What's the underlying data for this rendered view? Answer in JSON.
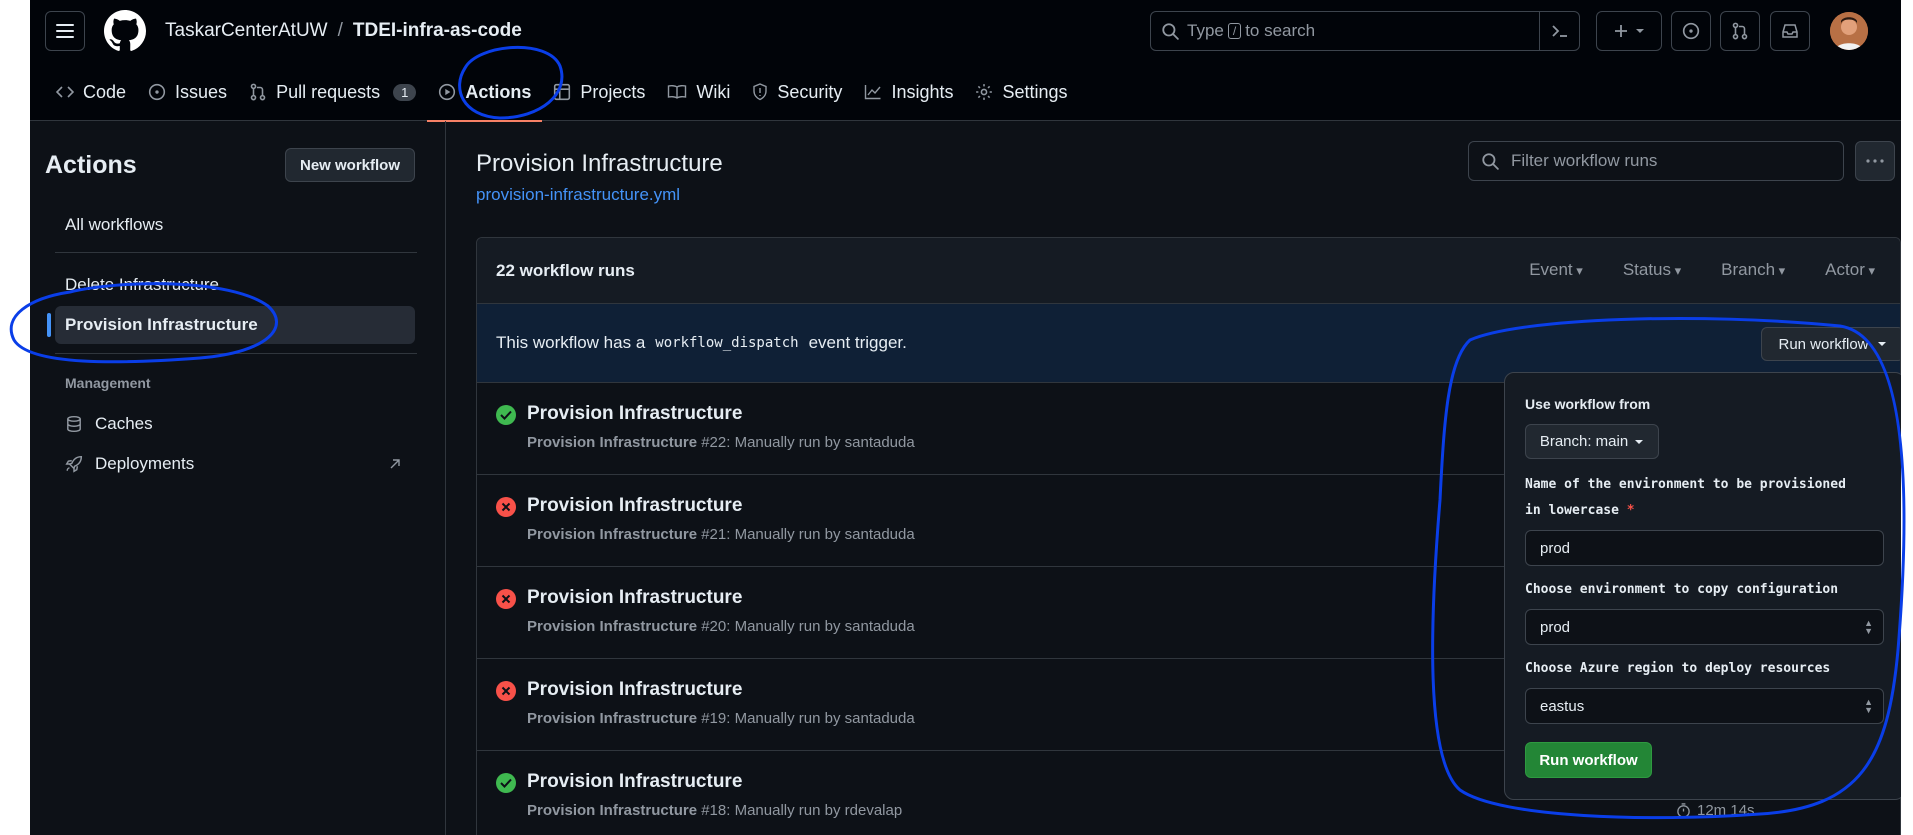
{
  "header": {
    "owner": "TaskarCenterAtUW",
    "separator": "/",
    "repo": "TDEI-infra-as-code",
    "search": {
      "prefix": "Type",
      "key": "/",
      "suffix": "to search"
    }
  },
  "tabs": [
    {
      "label": "Code",
      "icon": "code-icon"
    },
    {
      "label": "Issues",
      "icon": "issue-opened-icon"
    },
    {
      "label": "Pull requests",
      "icon": "git-pull-request-icon",
      "count": "1"
    },
    {
      "label": "Actions",
      "icon": "play-icon",
      "active": true
    },
    {
      "label": "Projects",
      "icon": "table-icon"
    },
    {
      "label": "Wiki",
      "icon": "book-icon"
    },
    {
      "label": "Security",
      "icon": "shield-icon"
    },
    {
      "label": "Insights",
      "icon": "graph-icon"
    },
    {
      "label": "Settings",
      "icon": "gear-icon"
    }
  ],
  "sidebar": {
    "title": "Actions",
    "new_workflow": "New workflow",
    "all_workflows": "All workflows",
    "workflows": [
      "Delete Infrastructure",
      "Provision Infrastructure"
    ],
    "management_label": "Management",
    "caches": "Caches",
    "deployments": "Deployments"
  },
  "main": {
    "title": "Provision Infrastructure",
    "file": "provision-infrastructure.yml",
    "filter_placeholder": "Filter workflow runs",
    "runs_count": "22 workflow runs",
    "filters": [
      "Event",
      "Status",
      "Branch",
      "Actor"
    ],
    "dispatch": {
      "before": "This workflow has a",
      "code": "workflow_dispatch",
      "after": "event trigger."
    },
    "run_workflow_button": "Run workflow",
    "runs": [
      {
        "status": "success",
        "title": "Provision Infrastructure",
        "workflow": "Provision Infrastructure",
        "detail": "#22: Manually run by santaduda"
      },
      {
        "status": "failure",
        "title": "Provision Infrastructure",
        "workflow": "Provision Infrastructure",
        "detail": "#21: Manually run by santaduda"
      },
      {
        "status": "failure",
        "title": "Provision Infrastructure",
        "workflow": "Provision Infrastructure",
        "detail": "#20: Manually run by santaduda"
      },
      {
        "status": "failure",
        "title": "Provision Infrastructure",
        "workflow": "Provision Infrastructure",
        "detail": "#19: Manually run by santaduda"
      },
      {
        "status": "success",
        "title": "Provision Infrastructure",
        "workflow": "Provision Infrastructure",
        "detail": "#18: Manually run by rdevalap"
      }
    ],
    "last_duration": "12m 14s"
  },
  "popover": {
    "use_from": "Use workflow from",
    "branch": "Branch: main",
    "env_label_1": "Name of the environment to be provisioned",
    "env_label_2": "in lowercase",
    "required": "*",
    "env_value": "prod",
    "copy_label": "Choose environment to copy configuration",
    "copy_value": "prod",
    "region_label": "Choose Azure region to deploy resources",
    "region_value": "eastus",
    "submit": "Run workflow"
  },
  "colors": {
    "accent": "#4493f8",
    "success": "#3fb950",
    "danger": "#f85149",
    "primary_button": "#238636",
    "annotation": "#0a3ee8"
  }
}
